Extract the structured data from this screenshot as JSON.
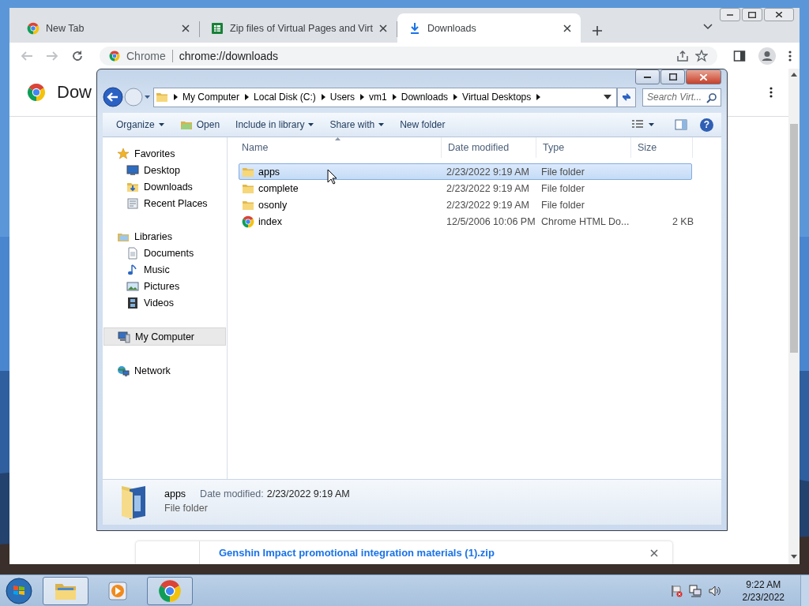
{
  "chrome": {
    "tabs": [
      {
        "title": "New Tab",
        "kind": "chrome",
        "selected": false
      },
      {
        "title": "Zip files of Virtual Pages and Virt",
        "kind": "sheet",
        "selected": false
      },
      {
        "title": "Downloads",
        "kind": "download",
        "selected": true
      }
    ],
    "omnibox": {
      "site": "Chrome",
      "url": "chrome://downloads"
    },
    "page_title": "Dow",
    "download_item": {
      "file_name": "Genshin Impact promotional integration materials (1).zip"
    }
  },
  "explorer": {
    "breadcrumbs": [
      "My Computer",
      "Local Disk (C:)",
      "Users",
      "vm1",
      "Downloads",
      "Virtual Desktops"
    ],
    "search": {
      "placeholder": "Search Virt..."
    },
    "toolbar": [
      {
        "label": "Organize",
        "kind": "menu"
      },
      {
        "label": "Open",
        "kind": "open"
      },
      {
        "label": "Include in library",
        "kind": "menu"
      },
      {
        "label": "Share with",
        "kind": "menu"
      },
      {
        "label": "New folder",
        "kind": "plain"
      }
    ],
    "help": "?",
    "sidebar": [
      {
        "label": "Favorites",
        "kind": "star",
        "selected": false,
        "children": [
          {
            "label": "Desktop",
            "kind": "desktop",
            "selected": false
          },
          {
            "label": "Downloads",
            "kind": "downloads",
            "selected": false
          },
          {
            "label": "Recent Places",
            "kind": "recent",
            "selected": false
          }
        ]
      },
      {
        "label": "Libraries",
        "kind": "libraries",
        "selected": false,
        "children": [
          {
            "label": "Documents",
            "kind": "document",
            "selected": false
          },
          {
            "label": "Music",
            "kind": "music",
            "selected": false
          },
          {
            "label": "Pictures",
            "kind": "pictures",
            "selected": false
          },
          {
            "label": "Videos",
            "kind": "videos",
            "selected": false
          }
        ]
      },
      {
        "label": "My Computer",
        "kind": "computer",
        "selected": true
      },
      {
        "label": "Network",
        "kind": "network",
        "selected": false
      }
    ],
    "columns": [
      {
        "label": "Name",
        "sorted": true
      },
      {
        "label": "Date modified",
        "sorted": false
      },
      {
        "label": "Type",
        "sorted": false
      },
      {
        "label": "Size",
        "sorted": false
      }
    ],
    "rows": [
      {
        "name": "apps",
        "kind": "folder",
        "date": "2/23/2022 9:19 AM",
        "type": "File folder",
        "selected": true
      },
      {
        "name": "complete",
        "kind": "folder",
        "date": "2/23/2022 9:19 AM",
        "type": "File folder",
        "selected": false
      },
      {
        "name": "osonly",
        "kind": "folder",
        "date": "2/23/2022 9:19 AM",
        "type": "File folder",
        "selected": false
      },
      {
        "name": "index",
        "kind": "chrome",
        "date": "12/5/2006 10:06 PM",
        "type": "Chrome HTML Do...",
        "size": "2 KB",
        "selected": false
      }
    ],
    "details": {
      "name": "apps",
      "date_label": "Date modified:",
      "date": "2/23/2022 9:19 AM",
      "type": "File folder"
    }
  },
  "taskbar": {
    "items": [
      {
        "kind": "explorer",
        "selected": true,
        "running": true
      },
      {
        "kind": "media",
        "selected": false,
        "running": false
      },
      {
        "kind": "chrome",
        "selected": false,
        "running": true
      }
    ],
    "time": "9:22 AM",
    "date": "2/23/2022"
  }
}
